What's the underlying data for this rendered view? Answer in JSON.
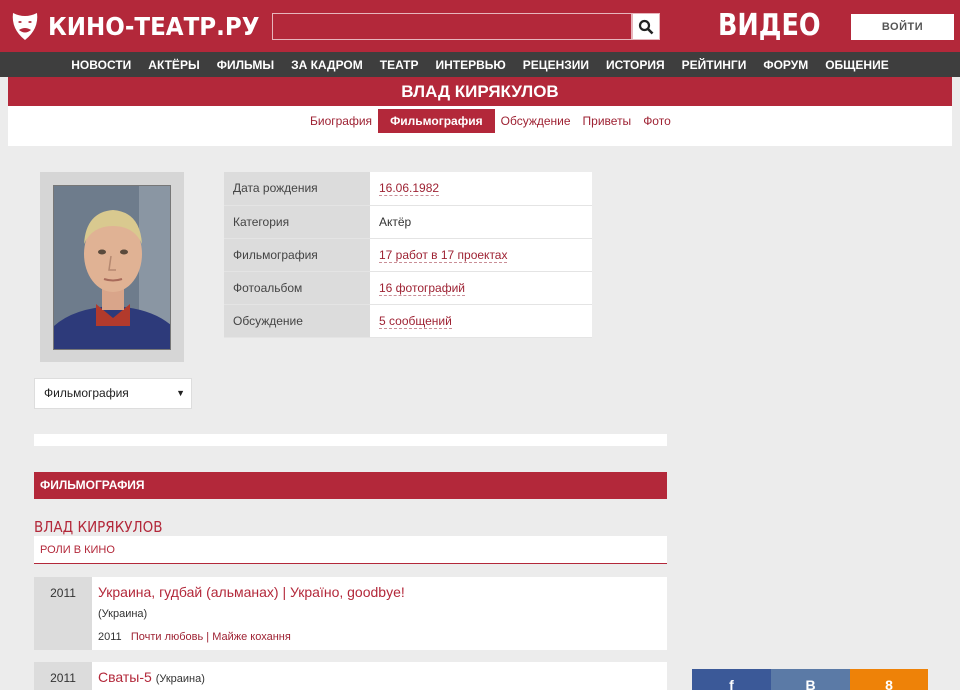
{
  "header": {
    "logo_text": "КИНО-ТЕАТР.РУ",
    "search_value": "",
    "video_label": "ВИДЕО",
    "login_label": "ВОЙТИ"
  },
  "nav": [
    "НОВОСТИ",
    "АКТЁРЫ",
    "ФИЛЬМЫ",
    "ЗА КАДРОМ",
    "ТЕАТР",
    "ИНТЕРВЬЮ",
    "РЕЦЕНЗИИ",
    "ИСТОРИЯ",
    "РЕЙТИНГИ",
    "ФОРУМ",
    "ОБЩЕНИЕ"
  ],
  "person": {
    "name": "ВЛАД КИРЯКУЛОВ",
    "tabs": [
      "Биография",
      "Фильмография",
      "Обсуждение",
      "Приветы",
      "Фото"
    ],
    "active_tab": "Фильмография"
  },
  "info": [
    {
      "label": "Дата рождения",
      "value": "16.06.1982",
      "link": true
    },
    {
      "label": "Категория",
      "value": "Актёр",
      "link": false
    },
    {
      "label": "Фильмография",
      "value": "17 работ в 17 проектах",
      "link": true
    },
    {
      "label": "Фотоальбом",
      "value": "16 фотографий",
      "link": true
    },
    {
      "label": "Обсуждение",
      "value": "5 сообщений",
      "link": true
    }
  ],
  "select": {
    "value": "Фильмография"
  },
  "filmography": {
    "section_title": "ФИЛЬМОГРАФИЯ",
    "actor_name": "ВЛАД КИРЯКУЛОВ",
    "roles_title": "РОЛИ В КИНО",
    "films": [
      {
        "year": "2011",
        "title": "Украина, гудбай (альманах) | Україно, goodbye!",
        "country": "(Украина)",
        "meta_year": "2011",
        "meta_link": "Почти любовь | Майже кохання"
      },
      {
        "year": "2011",
        "title": "Сваты-5",
        "country": "(Украина)"
      }
    ]
  },
  "share": {
    "fb": "f",
    "vk": "В",
    "ok": "8"
  },
  "colors": {
    "brand": "#b3283a",
    "nav": "#3e3e3e",
    "background": "#ececec"
  }
}
